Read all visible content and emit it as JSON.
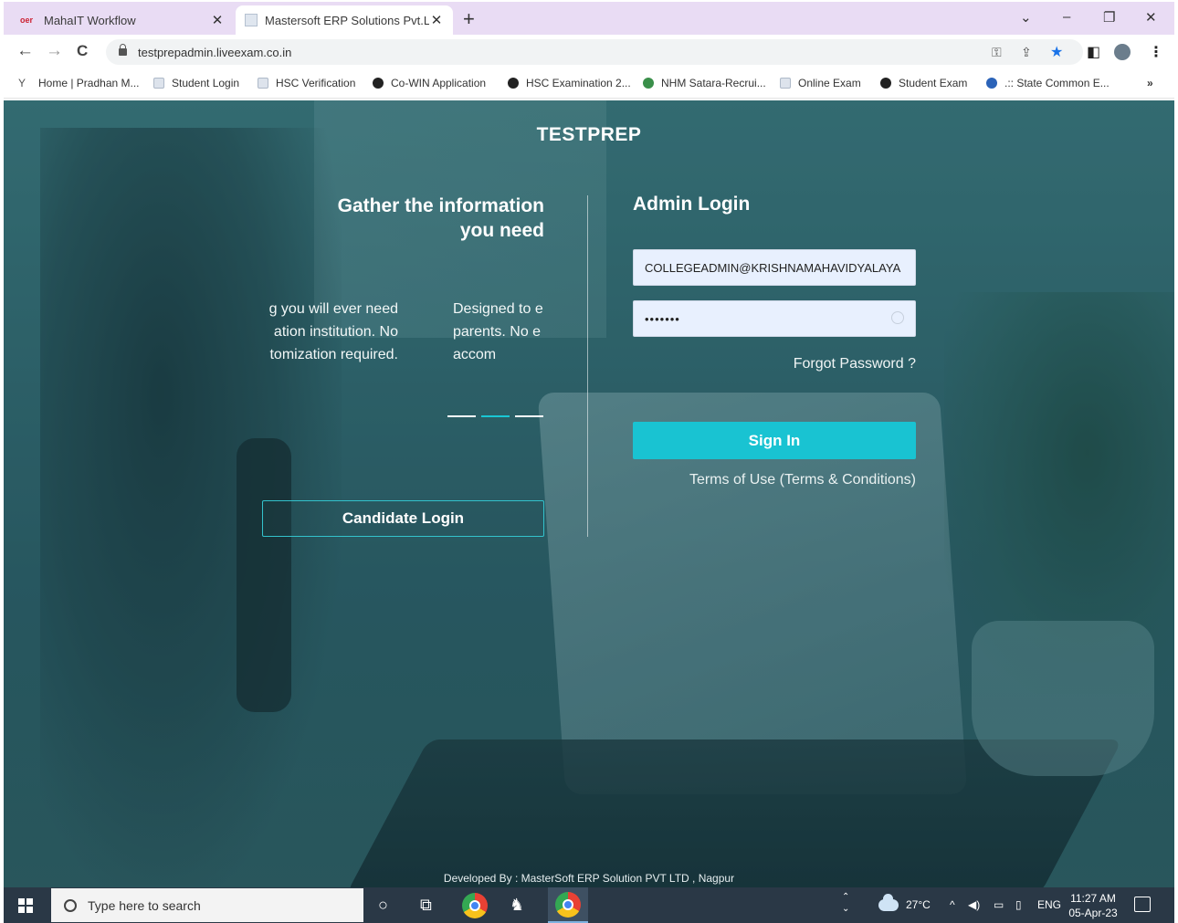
{
  "browser": {
    "tabs": [
      {
        "favicon": "oer",
        "title": "MahaIT Workflow",
        "active": false
      },
      {
        "favicon": "doc-icon",
        "title": "Mastersoft ERP Solutions Pvt.Ltd",
        "active": true
      }
    ],
    "new_tab": "+",
    "window_controls": {
      "list": "⌄",
      "minimize": "–",
      "restore": "❐",
      "close": "✕"
    },
    "nav": {
      "back": "←",
      "forward": "→",
      "reload": "C"
    },
    "url": "testprepadmin.liveexam.co.in",
    "bookmarks": [
      {
        "icon": "y",
        "label": "Home | Pradhan M..."
      },
      {
        "icon": "doc",
        "label": "Student Login"
      },
      {
        "icon": "doc",
        "label": "HSC Verification"
      },
      {
        "icon": "round",
        "label": "Co-WIN Application"
      },
      {
        "icon": "round",
        "label": "HSC Examination 2..."
      },
      {
        "icon": "green",
        "label": "NHM Satara-Recrui..."
      },
      {
        "icon": "doc",
        "label": "Online Exam"
      },
      {
        "icon": "round",
        "label": "Student Exam"
      },
      {
        "icon": "blue",
        "label": ".:: State Common E..."
      }
    ],
    "bookmarks_overflow": "»"
  },
  "page": {
    "brand": "TESTPREP",
    "info_heading_line1": "Gather the information",
    "info_heading_line2": "you need",
    "slides": [
      "g you will ever need\nation institution. No\ntomization required.",
      "Designed to e\nparents. No e\naccom"
    ],
    "candidate_login": "Candidate Login",
    "admin_heading": "Admin Login",
    "email_value": "COLLEGEADMIN@KRISHNAMAHAVIDYALAYA",
    "password_value": "•••••••",
    "forgot_password": "Forgot Password ?",
    "sign_in": "Sign In",
    "terms": "Terms of Use (Terms & Conditions)",
    "developed_by": "Developed By : MasterSoft ERP Solution PVT LTD , Nagpur"
  },
  "taskbar": {
    "search_placeholder": "Type here to search",
    "weather": "27°C",
    "language": "ENG",
    "time": "11:27 AM",
    "date": "05-Apr-23"
  },
  "colors": {
    "accent": "#19c3d2",
    "tab_strip": "#e9dcf4",
    "taskbar": "#2a3846",
    "input_bg": "#e8f0fe"
  }
}
